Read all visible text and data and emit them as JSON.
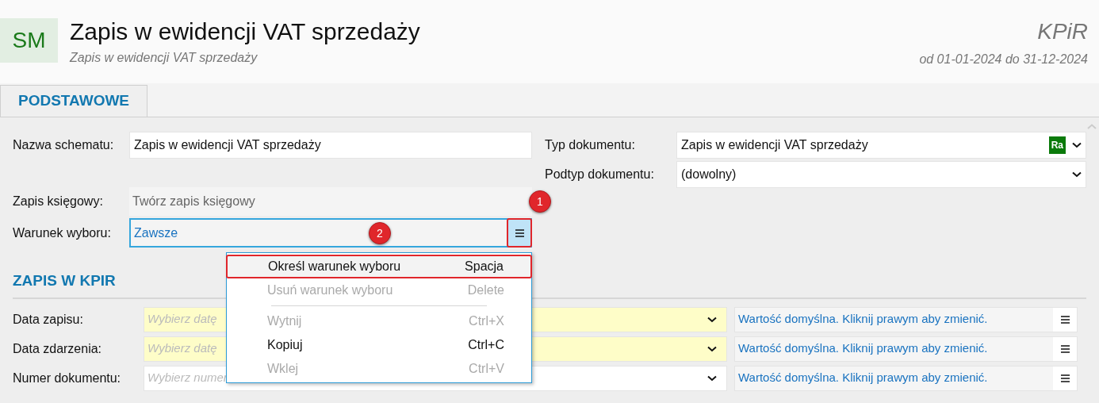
{
  "header": {
    "logo": "SM",
    "title": "Zapis w ewidencji VAT sprzedaży",
    "subtitle": "Zapis w ewidencji VAT sprzedaży",
    "module": "KPiR",
    "period": "od 01-01-2024 do 31-12-2024"
  },
  "tabs": [
    {
      "label": "PODSTAWOWE",
      "selected": true
    }
  ],
  "form_left": [
    {
      "label": "Nazwa schematu:",
      "value": "Zapis w ewidencji VAT sprzedaży",
      "kind": "text"
    },
    {
      "label": "Zapis księgowy:",
      "value": "Twórz zapis księgowy",
      "kind": "readonly",
      "badge": "1"
    },
    {
      "label": "Warunek wyboru:",
      "value": "Zawsze",
      "kind": "menu",
      "badge": "2"
    }
  ],
  "form_right": [
    {
      "label": "Typ dokumentu:",
      "value": "Zapis w ewidencji VAT sprzedaży",
      "tag": "Ra"
    },
    {
      "label": "Podtyp dokumentu:",
      "value": "(dowolny)"
    }
  ],
  "section": {
    "title": "ZAPIS W KPIR"
  },
  "kpir_rows": [
    {
      "label": "Data zapisu:",
      "placeholder": "Wybierz datę",
      "required": true,
      "default_text": "Wartość domyślna. Kliknij prawym aby zmienić."
    },
    {
      "label": "Data zdarzenia:",
      "placeholder": "Wybierz datę",
      "required": true,
      "default_text": "Wartość domyślna. Kliknij prawym aby zmienić."
    },
    {
      "label": "Numer dokumentu:",
      "placeholder": "Wybierz numer",
      "required": false,
      "default_text": "Wartość domyślna. Kliknij prawym aby zmienić."
    }
  ],
  "context_menu": [
    {
      "kind": "item",
      "label": "Określ warunek wyboru",
      "shortcut": "Spacja",
      "disabled": false,
      "selected": true
    },
    {
      "kind": "item",
      "label": "Usuń warunek wyboru",
      "shortcut": "Delete",
      "disabled": true,
      "selected": false
    },
    {
      "kind": "separator"
    },
    {
      "kind": "item",
      "label": "Wytnij",
      "shortcut": "Ctrl+X",
      "disabled": true,
      "selected": false
    },
    {
      "kind": "item",
      "label": "Kopiuj",
      "shortcut": "Ctrl+C",
      "disabled": false,
      "selected": false
    },
    {
      "kind": "item",
      "label": "Wklej",
      "shortcut": "Ctrl+V",
      "disabled": true,
      "selected": false
    }
  ]
}
